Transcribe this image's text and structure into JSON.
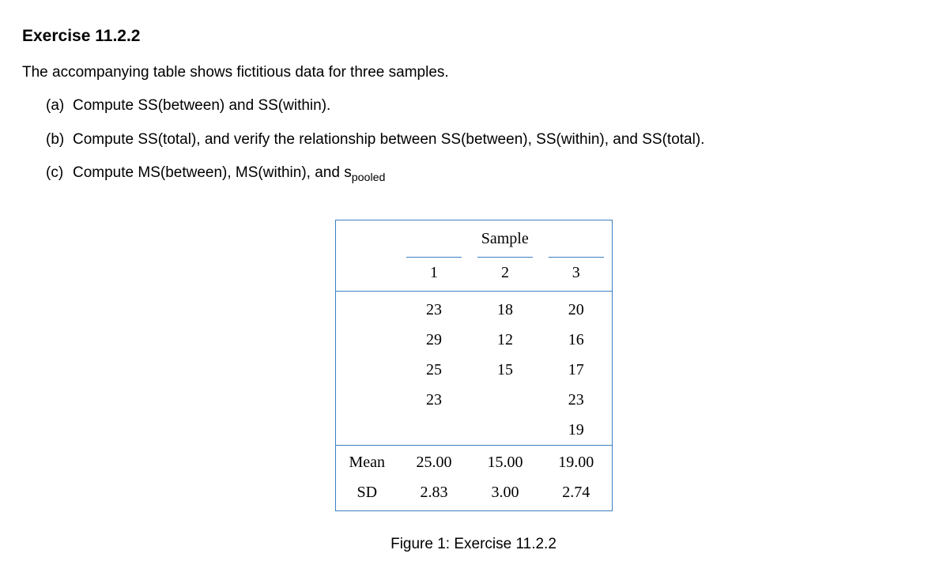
{
  "exercise": {
    "title": "Exercise 11.2.2",
    "intro": "The accompanying table shows fictitious data for three samples.",
    "items": {
      "a": {
        "label": "(a)",
        "text": "Compute SS(between) and SS(within)."
      },
      "b": {
        "label": "(b)",
        "text": "Compute SS(total), and verify the relationship between SS(between), SS(within), and SS(total)."
      },
      "c": {
        "label": "(c)",
        "text_prefix": "Compute MS(between), MS(within), and s",
        "text_sub": "pooled"
      }
    }
  },
  "table": {
    "header_span": "Sample",
    "cols": {
      "c1": "1",
      "c2": "2",
      "c3": "3"
    },
    "rows": [
      {
        "c1": "23",
        "c2": "18",
        "c3": "20"
      },
      {
        "c1": "29",
        "c2": "12",
        "c3": "16"
      },
      {
        "c1": "25",
        "c2": "15",
        "c3": "17"
      },
      {
        "c1": "23",
        "c2": "",
        "c3": "23"
      },
      {
        "c1": "",
        "c2": "",
        "c3": "19"
      }
    ],
    "summary": {
      "mean": {
        "label": "Mean",
        "c1": "25.00",
        "c2": "15.00",
        "c3": "19.00"
      },
      "sd": {
        "label": "SD",
        "c1": "2.83",
        "c2": "3.00",
        "c3": "2.74"
      }
    }
  },
  "caption": "Figure 1: Exercise 11.2.2",
  "chart_data": {
    "type": "table",
    "title": "Exercise 11.2.2 — fictitious data for three samples",
    "columns": [
      "Sample 1",
      "Sample 2",
      "Sample 3"
    ],
    "data": {
      "Sample 1": [
        23,
        29,
        25,
        23
      ],
      "Sample 2": [
        18,
        12,
        15
      ],
      "Sample 3": [
        20,
        16,
        17,
        23,
        19
      ]
    },
    "summary_stats": {
      "Mean": {
        "Sample 1": 25.0,
        "Sample 2": 15.0,
        "Sample 3": 19.0
      },
      "SD": {
        "Sample 1": 2.83,
        "Sample 2": 3.0,
        "Sample 3": 2.74
      }
    }
  }
}
